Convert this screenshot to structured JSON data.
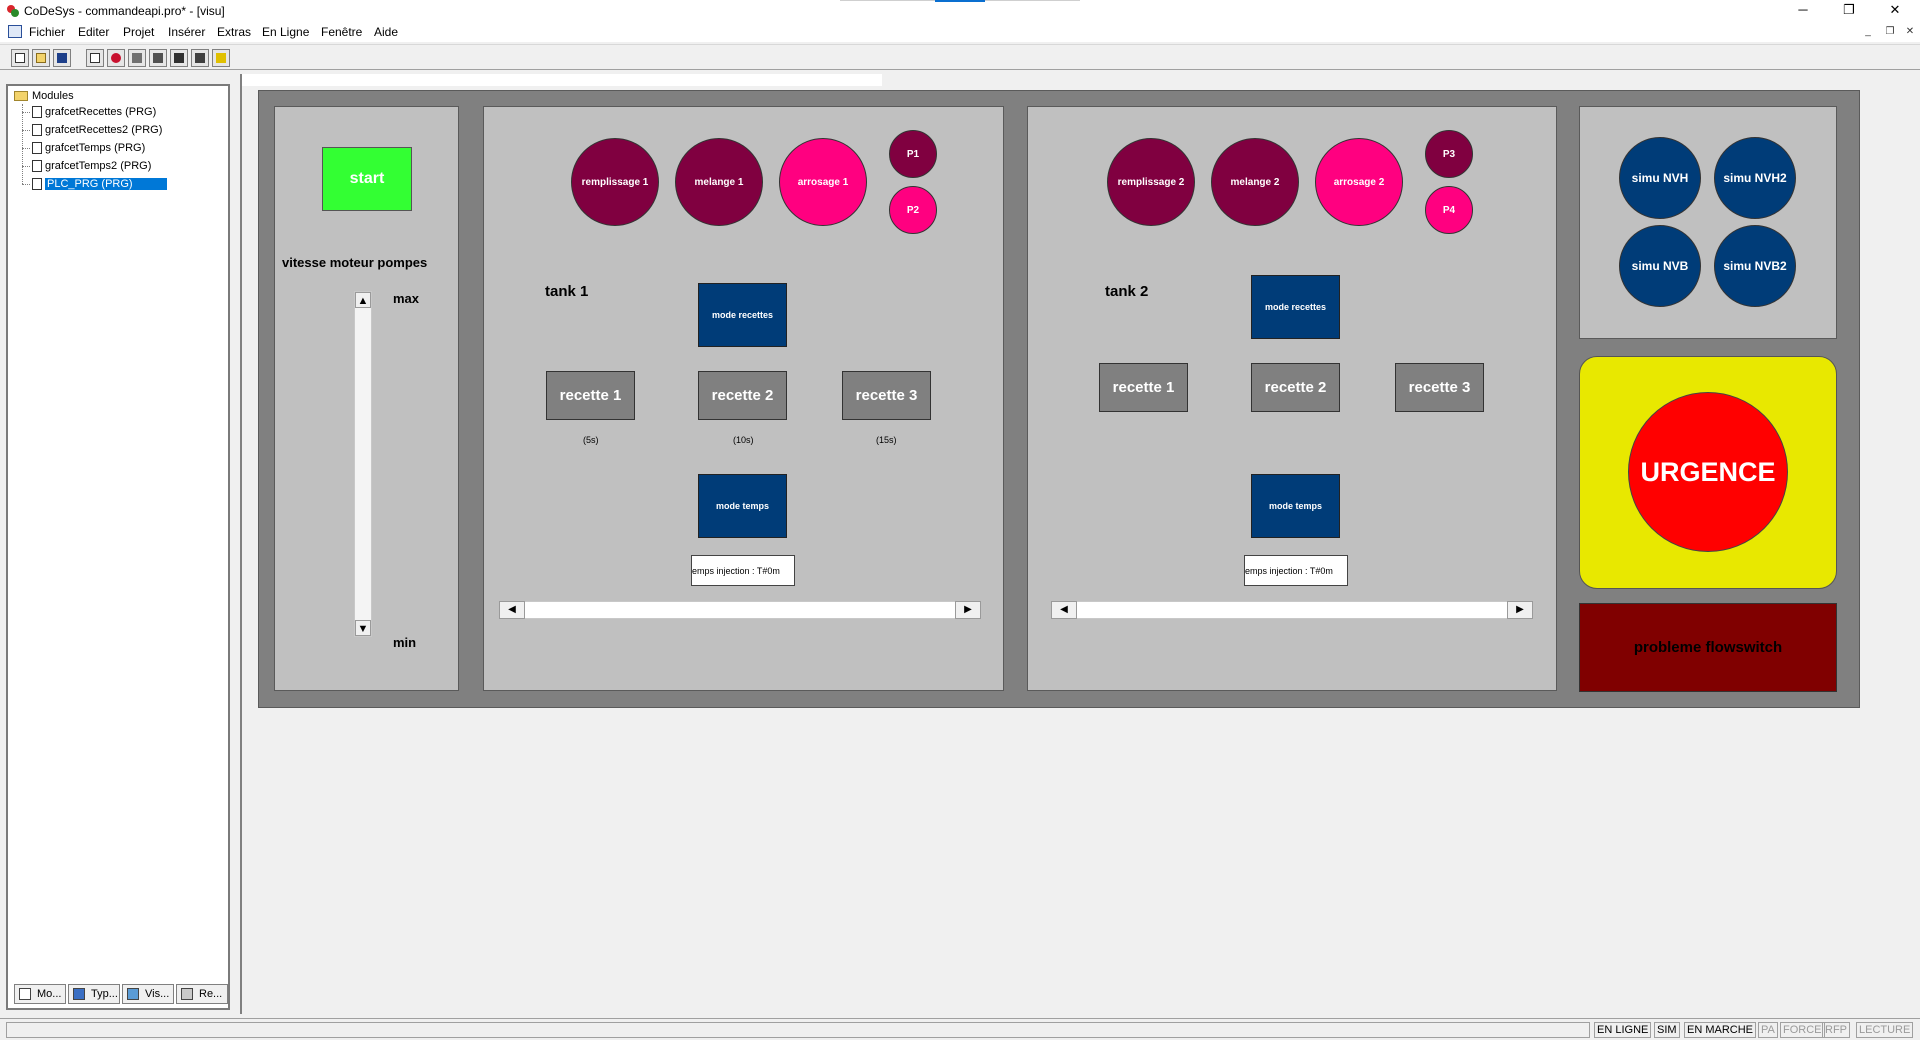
{
  "window": {
    "title": "CoDeSys - commandeapi.pro* - [visu]",
    "controls": {
      "minimize": "─",
      "maximize": "❐",
      "close": "✕"
    },
    "mdi_controls": {
      "minimize": "_",
      "restore": "❐",
      "close": "✕"
    }
  },
  "menu": [
    "Fichier",
    "Editer",
    "Projet",
    "Insérer",
    "Extras",
    "En Ligne",
    "Fenêtre",
    "Aide"
  ],
  "toolbar": {
    "buttons": [
      "new-icon",
      "open-icon",
      "save-icon",
      "build-icon",
      "stop-icon",
      "login-icon",
      "logout-icon",
      "run-icon",
      "step-icon",
      "online-icon"
    ]
  },
  "tree": {
    "root": "Modules",
    "items": [
      {
        "label": "grafcetRecettes (PRG)",
        "selected": false
      },
      {
        "label": "grafcetRecettes2 (PRG)",
        "selected": false
      },
      {
        "label": "grafcetTemps (PRG)",
        "selected": false
      },
      {
        "label": "grafcetTemps2 (PRG)",
        "selected": false
      },
      {
        "label": "PLC_PRG (PRG)",
        "selected": true
      }
    ],
    "tabs": [
      "Mo...",
      "Typ...",
      "Vis...",
      "Re..."
    ]
  },
  "visu": {
    "pump_panel": {
      "start_label": "start",
      "speed_label": "vitesse moteur pompes",
      "max_label": "max",
      "min_label": "min",
      "up_arrow": "▲",
      "down_arrow": "▼"
    },
    "tank1": {
      "tank_label": "tank 1",
      "circles": [
        "remplissage 1",
        "melange 1",
        "arrosage 1"
      ],
      "pumps": [
        "P1",
        "P2"
      ],
      "mode_recettes": "mode recettes",
      "mode_temps": "mode temps",
      "recettes": [
        "recette 1",
        "recette 2",
        "recette 3"
      ],
      "durations": [
        "(5s)",
        "(10s)",
        "(15s)"
      ],
      "injection_text": "emps injection : T#0m",
      "scroll_left": "◀",
      "scroll_right": "▶"
    },
    "tank2": {
      "tank_label": "tank 2",
      "circles": [
        "remplissage 2",
        "melange 2",
        "arrosage 2"
      ],
      "pumps": [
        "P3",
        "P4"
      ],
      "mode_recettes": "mode recettes",
      "mode_temps": "mode temps",
      "recettes": [
        "recette 1",
        "recette 2",
        "recette 3"
      ],
      "injection_text": "emps injection : T#0m",
      "scroll_left": "◀",
      "scroll_right": "▶"
    },
    "simu": [
      "simu NVH",
      "simu NVH2",
      "simu NVB",
      "simu NVB2"
    ],
    "urgence": "URGENCE",
    "flowswitch": "probleme flowswitch"
  },
  "statusbar": {
    "items": [
      {
        "label": "EN LIGNE",
        "dim": false
      },
      {
        "label": "SIM",
        "dim": false
      },
      {
        "label": "EN MARCHE",
        "dim": false
      },
      {
        "label": "PA",
        "dim": true
      },
      {
        "label": "FORCE",
        "dim": true
      },
      {
        "label": "RFP",
        "dim": true
      },
      {
        "label": "LECTURE",
        "dim": true
      }
    ]
  },
  "colors": {
    "dark_circle": "#800040",
    "pink_circle": "#ff0080",
    "blue": "#003c78",
    "start_green": "#33ff33",
    "urgence_red": "#ff0000",
    "urgence_bg": "#e8e800",
    "flowswitch_bg": "#800000",
    "selection": "#0078d7"
  }
}
